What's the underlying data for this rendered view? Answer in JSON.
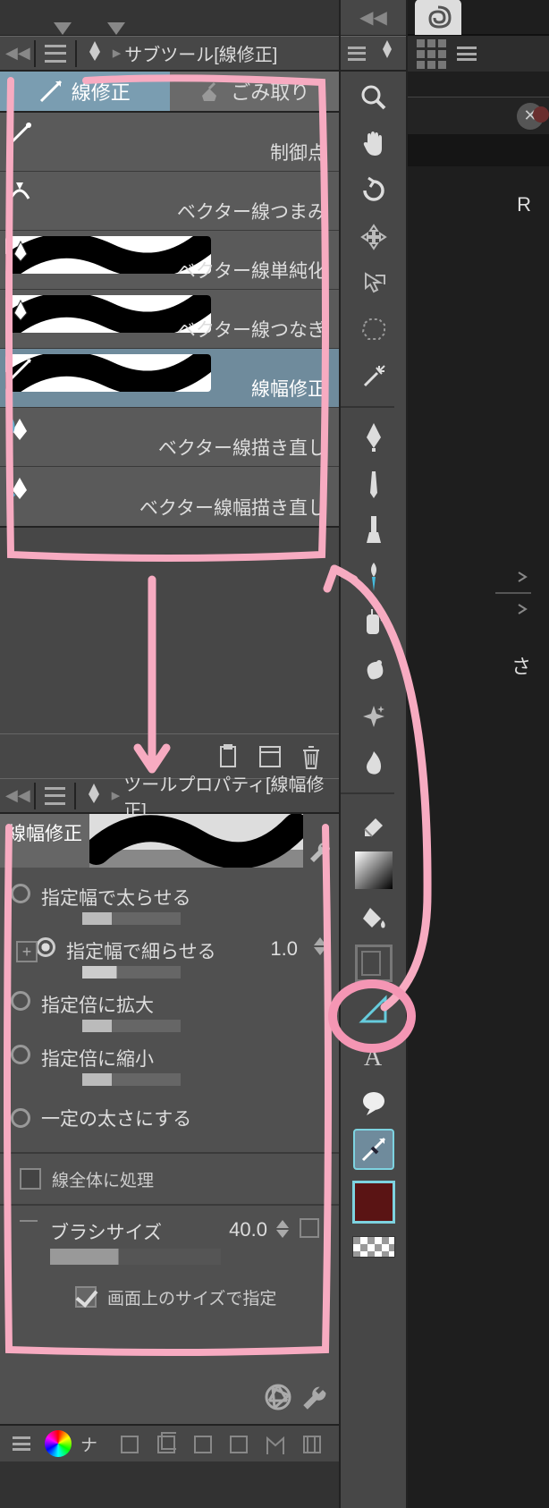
{
  "subtool_panel": {
    "title": "サブツール[線修正]",
    "tabs": [
      {
        "label": "線修正",
        "active": true
      },
      {
        "label": "ごみ取り",
        "active": false
      }
    ],
    "items": [
      {
        "label": "制御点",
        "selected": false,
        "thumb": false
      },
      {
        "label": "ベクター線つまみ",
        "selected": false,
        "thumb": false
      },
      {
        "label": "ベクター線単純化",
        "selected": false,
        "thumb": true
      },
      {
        "label": "ベクター線つなぎ",
        "selected": false,
        "thumb": true
      },
      {
        "label": "線幅修正",
        "selected": true,
        "thumb": true
      },
      {
        "label": "ベクター線描き直し",
        "selected": false,
        "thumb": false
      },
      {
        "label": "ベクター線幅描き直し",
        "selected": false,
        "thumb": false
      }
    ]
  },
  "tool_property": {
    "title": "ツールプロパティ[線幅修正]",
    "preview_label": "線幅修正",
    "options": [
      {
        "label": "指定幅で太らせる",
        "selected": false
      },
      {
        "label": "指定幅で細らせる",
        "selected": true
      },
      {
        "label": "指定倍に拡大",
        "selected": false
      },
      {
        "label": "指定倍に縮小",
        "selected": false
      },
      {
        "label": "一定の太さにする",
        "selected": false
      }
    ],
    "value_width": "1.0",
    "process_whole_line": {
      "label": "線全体に処理",
      "checked": false
    },
    "brush_size": {
      "label": "ブラシサイズ",
      "value": "40.0"
    },
    "specify_on_screen": {
      "label": "画面上のサイズで指定",
      "checked": true
    }
  },
  "vt": {
    "tools_top": [
      "zoom-icon",
      "hand-icon",
      "rotate-icon",
      "move-tool-icon",
      "select-transform-icon",
      "lasso-icon",
      "wand-icon"
    ],
    "tools_mid": [
      "pen-icon",
      "pencil-icon",
      "brush-icon",
      "paint-brush-icon",
      "airbrush-icon",
      "deco-brush-icon",
      "sparkle-icon",
      "blend-icon"
    ],
    "tools_low": [
      "eraser-tool-icon",
      "gradient-swatch",
      "fill-icon",
      "frame-icon",
      "ruler-icon",
      "text-icon",
      "balloon-icon"
    ],
    "selected": "line-correct-tool-icon"
  },
  "nav_footer": {
    "label": "ナ"
  },
  "col3": {
    "letter1": "R",
    "letter2": "さ"
  }
}
